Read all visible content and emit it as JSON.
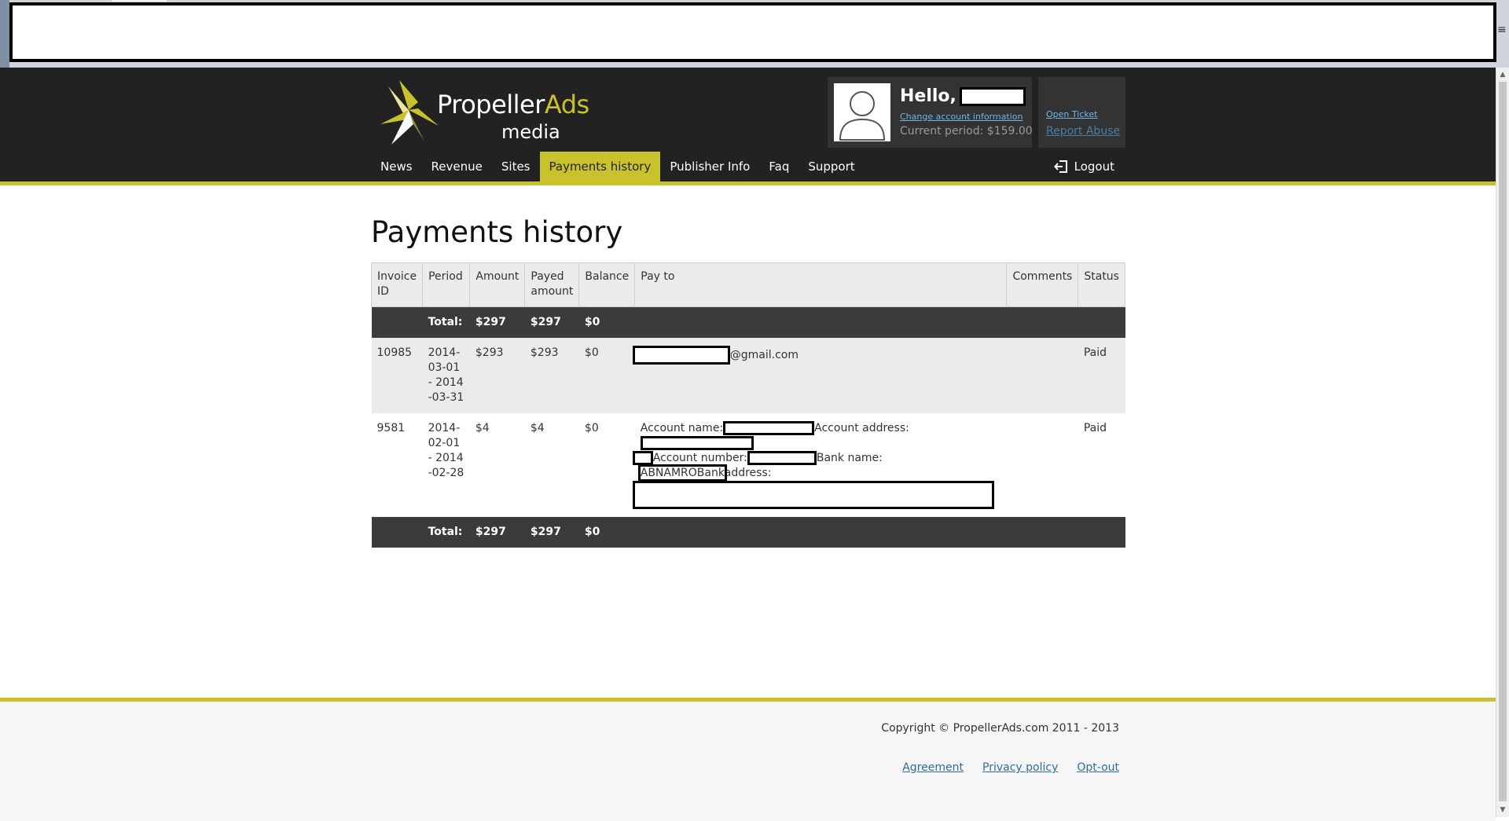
{
  "header": {
    "logo_main": "Propeller",
    "logo_accent": "Ads",
    "logo_sub": "media",
    "hello": "Hello,",
    "change_account": "Change account information",
    "current_period": "Current period: $159.00",
    "open_ticket": "Open Ticket",
    "report_abuse": "Report Abuse",
    "logout": "Logout"
  },
  "nav": {
    "items": [
      "News",
      "Revenue",
      "Sites",
      "Payments history",
      "Publisher Info",
      "Faq",
      "Support"
    ],
    "active": "Payments history"
  },
  "main": {
    "title": "Payments history",
    "columns": [
      "Invoice ID",
      "Period",
      "Amount",
      "Payed amount",
      "Balance",
      "Pay to",
      "Comments",
      "Status"
    ],
    "totals": {
      "label": "Total:",
      "amount": "$297",
      "payed": "$297",
      "balance": "$0"
    },
    "rows": [
      {
        "invoice": "10985",
        "period": "2014-03-01 - 2014-03-31",
        "amount": "$293",
        "payed": "$293",
        "balance": "$0",
        "pay_to_suffix": "@gmail.com",
        "comments": "",
        "status": "Paid"
      },
      {
        "invoice": "9581",
        "period": "2014-02-01 - 2014-02-28",
        "amount": "$4",
        "payed": "$4",
        "balance": "$0",
        "account_name_label": "Account name:",
        "account_address_label": "Account address:",
        "account_number_label": "Account number:",
        "bank_name_label": "Bank name:",
        "bank_name_value": "ABNAMROBank",
        "address_label": "address:",
        "comments": "",
        "status": "Paid"
      }
    ]
  },
  "footer": {
    "copyright": "Copyright © PropellerAds.com 2011 - 2013",
    "links": [
      "Agreement",
      "Privacy policy",
      "Opt-out"
    ]
  },
  "colors": {
    "accent": "#c8c22d",
    "header_bg": "#222222",
    "link": "#2f6e9c"
  }
}
